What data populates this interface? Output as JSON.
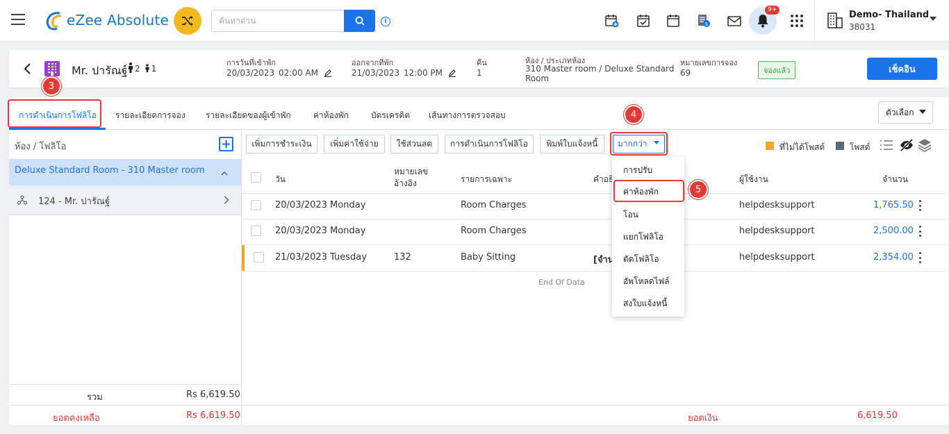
{
  "app": {
    "name": "eZee Absolute"
  },
  "search": {
    "placeholder": "ค้นหาด่วน"
  },
  "notifications": {
    "badge": "9+"
  },
  "property": {
    "name": "Demo- Thailand",
    "id": "38031"
  },
  "guest": {
    "name": "Mr. ปารัณฐ์",
    "adults": "2",
    "children": "1",
    "checkin_label": "การวันที่เข้าพัก",
    "checkin_date": "20/03/2023",
    "checkin_time": "02:00 AM",
    "checkout_label": "ออกจากที่พัก",
    "checkout_date": "21/03/2023",
    "checkout_time": "12:00 PM",
    "nights_label": "คืน",
    "nights": "1",
    "room_label": "ห้อง / ประเภทห้อง",
    "room_line1": "310 Master room / Deluxe Standard",
    "room_line2": "Room",
    "booking_label": "หมายเลขการจอง",
    "booking_no": "69",
    "status": "จองแล้ว",
    "checkin_button": "เช็คอิน"
  },
  "steps": {
    "s3": "3",
    "s4": "4",
    "s5": "5"
  },
  "tabs": [
    {
      "label": "การดำเนินการโฟลิโอ"
    },
    {
      "label": "รายละเอียดการจอง"
    },
    {
      "label": "รายละเอียดของผู้เข้าพัก"
    },
    {
      "label": "ค่าห้องพัก"
    },
    {
      "label": "บัตรเครดิต"
    },
    {
      "label": "เส้นทางการตรวจสอบ"
    }
  ],
  "options_button": "ตัวเลือก",
  "left": {
    "header": "ห้อง / โฟลิโอ",
    "room": "Deluxe Standard Room - 310 Master room",
    "folio": "124 - Mr. ปารัณฐ์",
    "total_label": "รวม",
    "total_value": "Rs 6,619.50",
    "balance_label": "ยอดคงเหลือ",
    "balance_value": "Rs 6,619.50"
  },
  "toolbar": {
    "add_payment": "เพิ่มการชำระเงิน",
    "add_charge": "เพิ่มค่าใช้จ่าย",
    "discount": "ใช้ส่วนลด",
    "folio_ops": "การดำเนินการโฟลิโอ",
    "print_invoice": "พิมพ์ใบแจ้งหนี้",
    "more": "มากกว่า"
  },
  "legend": {
    "unposted": "ที่ไม่ได้โพสต์",
    "posted": "โพสต์",
    "unposted_color": "#f5a623",
    "posted_color": "#5c6b7a"
  },
  "table": {
    "headers": {
      "date": "วัน",
      "ref1": "หมายเลข",
      "ref2": "อ้างอิง",
      "particulars": "รายการเฉพาะ",
      "description": "คำอธิ",
      "user": "ผู้ใช้งาน",
      "amount": "จำนวน"
    },
    "rows": [
      {
        "date": "20/03/2023 Monday",
        "ref": "",
        "particulars": "Room Charges",
        "description": "",
        "user": "helpdesksupport",
        "amount": "1,765.50"
      },
      {
        "date": "20/03/2023 Monday",
        "ref": "",
        "particulars": "Room Charges",
        "description": "",
        "user": "helpdesksupport",
        "amount": "2,500.00"
      },
      {
        "date": "21/03/2023 Tuesday",
        "ref": "132",
        "particulars": "Baby Sitting",
        "description": "[จำนว",
        "user": "helpdesksupport",
        "amount": "2,354.00"
      }
    ],
    "end_of_data": "End Of Data",
    "footer_label": "ยอดเงิน",
    "footer_value": "6,619.50"
  },
  "dropdown": [
    "การปรับ",
    "ค่าห้องพัก",
    "โอน",
    "แยกโฟลิโอ",
    "ตัดโฟลิโอ",
    "อัพโหลดไฟล์",
    "ส่งใบแจ้งหนี้"
  ]
}
